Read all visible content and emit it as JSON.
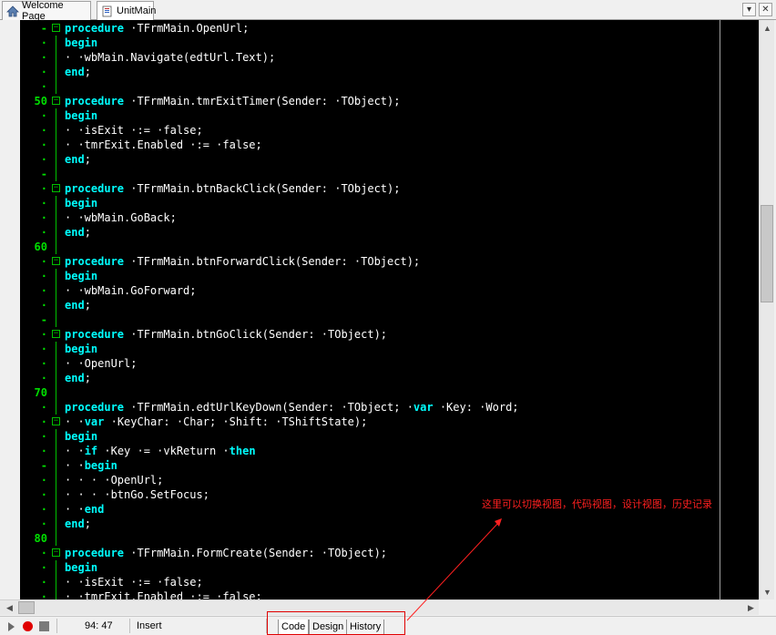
{
  "tabs": [
    {
      "label": "Welcome Page",
      "icon": "home-icon",
      "active": false
    },
    {
      "label": "UnitMain",
      "icon": "unit-file-icon",
      "active": true
    }
  ],
  "tabbar_buttons": [
    {
      "name": "tab-list-dropdown-button",
      "glyph": "▾"
    },
    {
      "name": "close-tab-button",
      "glyph": "✕"
    }
  ],
  "editor": {
    "lines": [
      {
        "num": "-",
        "fold": "minus",
        "code": [
          {
            "t": "procedure",
            "k": true
          },
          {
            "t": " ·TFrmMain.OpenUrl;"
          }
        ]
      },
      {
        "num": "·",
        "code": [
          {
            "t": "begin",
            "k": true
          }
        ]
      },
      {
        "num": "·",
        "code": [
          {
            "t": "· ·wbMain.Navigate(edtUrl.Text);"
          }
        ]
      },
      {
        "num": "·",
        "code": [
          {
            "t": "end",
            "k": true
          },
          {
            "t": ";"
          }
        ]
      },
      {
        "num": "·",
        "code": []
      },
      {
        "num": "50",
        "fold": "minus",
        "code": [
          {
            "t": "procedure",
            "k": true
          },
          {
            "t": " ·TFrmMain.tmrExitTimer(Sender: ·TObject);"
          }
        ]
      },
      {
        "num": "·",
        "code": [
          {
            "t": "begin",
            "k": true
          }
        ]
      },
      {
        "num": "·",
        "code": [
          {
            "t": "· ·isExit ·:= ·false;"
          }
        ]
      },
      {
        "num": "·",
        "code": [
          {
            "t": "· ·tmrExit.Enabled ·:= ·false;"
          }
        ]
      },
      {
        "num": "·",
        "code": [
          {
            "t": "end",
            "k": true
          },
          {
            "t": ";"
          }
        ]
      },
      {
        "num": "-",
        "code": []
      },
      {
        "num": "·",
        "fold": "minus",
        "code": [
          {
            "t": "procedure",
            "k": true
          },
          {
            "t": " ·TFrmMain.btnBackClick(Sender: ·TObject);"
          }
        ]
      },
      {
        "num": "·",
        "code": [
          {
            "t": "begin",
            "k": true
          }
        ]
      },
      {
        "num": "·",
        "code": [
          {
            "t": "· ·wbMain.GoBack;"
          }
        ]
      },
      {
        "num": "·",
        "code": [
          {
            "t": "end",
            "k": true
          },
          {
            "t": ";"
          }
        ]
      },
      {
        "num": "60",
        "code": []
      },
      {
        "num": "·",
        "fold": "minus",
        "code": [
          {
            "t": "procedure",
            "k": true
          },
          {
            "t": " ·TFrmMain.btnForwardClick(Sender: ·TObject);"
          }
        ]
      },
      {
        "num": "·",
        "code": [
          {
            "t": "begin",
            "k": true
          }
        ]
      },
      {
        "num": "·",
        "code": [
          {
            "t": "· ·wbMain.GoForward;"
          }
        ]
      },
      {
        "num": "·",
        "code": [
          {
            "t": "end",
            "k": true
          },
          {
            "t": ";"
          }
        ]
      },
      {
        "num": "-",
        "code": []
      },
      {
        "num": "·",
        "fold": "minus",
        "code": [
          {
            "t": "procedure",
            "k": true
          },
          {
            "t": " ·TFrmMain.btnGoClick(Sender: ·TObject);"
          }
        ]
      },
      {
        "num": "·",
        "code": [
          {
            "t": "begin",
            "k": true
          }
        ]
      },
      {
        "num": "·",
        "code": [
          {
            "t": "· ·OpenUrl;"
          }
        ]
      },
      {
        "num": "·",
        "code": [
          {
            "t": "end",
            "k": true
          },
          {
            "t": ";"
          }
        ]
      },
      {
        "num": "70",
        "code": []
      },
      {
        "num": "·",
        "code": [
          {
            "t": "procedure",
            "k": true
          },
          {
            "t": " ·TFrmMain.edtUrlKeyDown(Sender: ·TObject; ·"
          },
          {
            "t": "var",
            "k": true
          },
          {
            "t": " ·Key: ·Word;"
          }
        ]
      },
      {
        "num": "·",
        "fold": "minus",
        "code": [
          {
            "t": "· ·"
          },
          {
            "t": "var",
            "k": true
          },
          {
            "t": " ·KeyChar: ·Char; ·Shift: ·TShiftState);"
          }
        ]
      },
      {
        "num": "·",
        "code": [
          {
            "t": "begin",
            "k": true
          }
        ]
      },
      {
        "num": "·",
        "code": [
          {
            "t": "· ·"
          },
          {
            "t": "if",
            "k": true
          },
          {
            "t": " ·Key ·= ·vkReturn ·"
          },
          {
            "t": "then",
            "k": true
          }
        ]
      },
      {
        "num": "-",
        "code": [
          {
            "t": "· ·"
          },
          {
            "t": "begin",
            "k": true
          }
        ]
      },
      {
        "num": "·",
        "code": [
          {
            "t": "· · · ·OpenUrl;"
          }
        ]
      },
      {
        "num": "·",
        "code": [
          {
            "t": "· · · ·btnGo.SetFocus;"
          }
        ]
      },
      {
        "num": "·",
        "code": [
          {
            "t": "· ·"
          },
          {
            "t": "end",
            "k": true
          }
        ]
      },
      {
        "num": "·",
        "code": [
          {
            "t": "end",
            "k": true
          },
          {
            "t": ";"
          }
        ]
      },
      {
        "num": "80",
        "code": []
      },
      {
        "num": "·",
        "fold": "minus",
        "code": [
          {
            "t": "procedure",
            "k": true
          },
          {
            "t": " ·TFrmMain.FormCreate(Sender: ·TObject);"
          }
        ]
      },
      {
        "num": "·",
        "code": [
          {
            "t": "begin",
            "k": true
          }
        ]
      },
      {
        "num": "·",
        "code": [
          {
            "t": "· ·isExit ·:= ·false;"
          }
        ]
      },
      {
        "num": "·",
        "code": [
          {
            "t": "· ·tmrExit.Enabled ·:= ·false;"
          }
        ]
      }
    ]
  },
  "status": {
    "cursor_position": "94: 47",
    "insert_mode": "Insert"
  },
  "view_tabs": [
    {
      "label": "Code",
      "active": true
    },
    {
      "label": "Design",
      "active": false
    },
    {
      "label": "History",
      "active": false
    }
  ],
  "annotation": {
    "text": "这里可以切换视图，代码视图，设计视图，历史记录",
    "color": "#ff2020"
  },
  "colors": {
    "editor_bg": "#000000",
    "keyword": "#00ffff",
    "line_number": "#00e000",
    "text": "#ffffff"
  }
}
